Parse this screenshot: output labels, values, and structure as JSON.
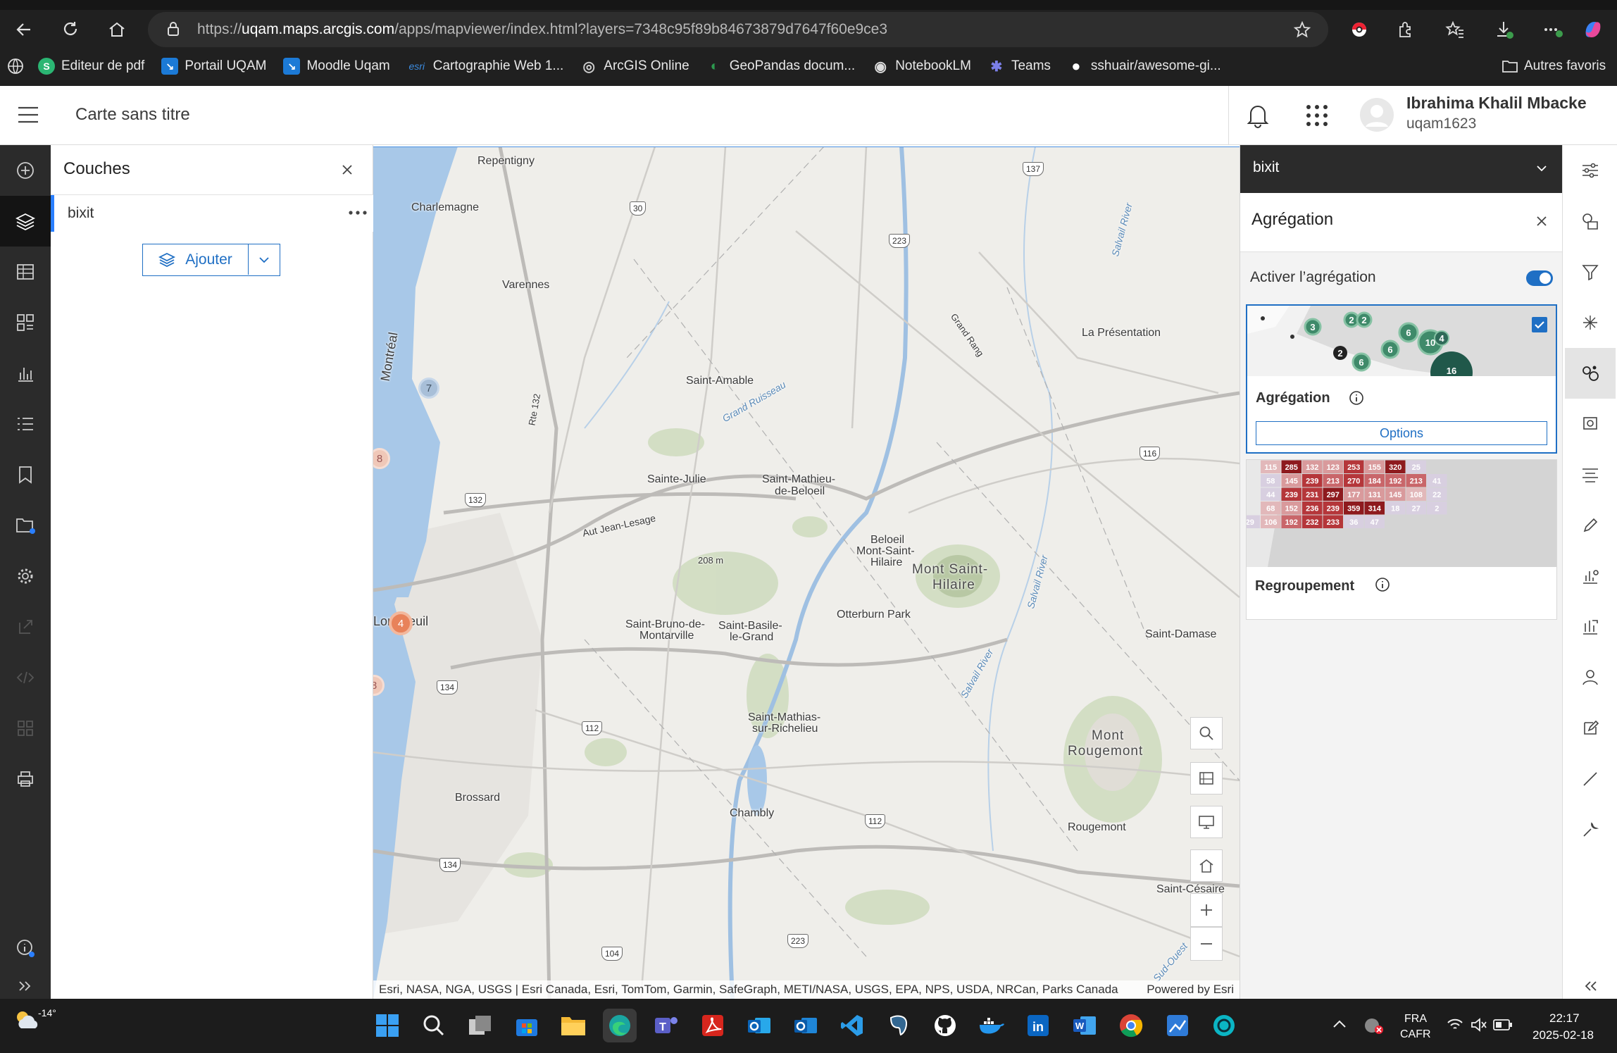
{
  "browser": {
    "url_prefix": "https://",
    "url_domain": "uqam.maps.arcgis.com",
    "url_path": "/apps/mapviewer/index.html?layers=7348c95f89b84673879d7647f60e9ce3",
    "bookmarks": [
      {
        "label": "Editeur de pdf",
        "color": "#2bb673",
        "glyph": "S"
      },
      {
        "label": "Portail UQAM",
        "color": "#1c7ad6",
        "glyph": "↘"
      },
      {
        "label": "Moodle Uqam",
        "color": "#1c7ad6",
        "glyph": "↘"
      },
      {
        "label": "Cartographie Web 1...",
        "color": "#2c6fb7",
        "glyph": "esri"
      },
      {
        "label": "ArcGIS Online",
        "color": "#444",
        "glyph": "◎"
      },
      {
        "label": "GeoPandas docum...",
        "color": "#1a7f3c",
        "glyph": "◐"
      },
      {
        "label": "NotebookLM",
        "color": "#555",
        "glyph": "◉"
      },
      {
        "label": "Teams",
        "color": "#5b5fc7",
        "glyph": "✱"
      },
      {
        "label": "sshuair/awesome-gi...",
        "color": "#333",
        "glyph": "●"
      }
    ],
    "other_bookmarks": "Autres favoris"
  },
  "header": {
    "map_title": "Carte sans titre",
    "user_name": "Ibrahima Khalil Mbacke",
    "user_id": "uqam1623"
  },
  "layers_panel": {
    "title": "Couches",
    "layer_name": "bixit",
    "add_label": "Ajouter"
  },
  "right_panel": {
    "layer_select": "bixit",
    "title": "Agrégation",
    "toggle_label": "Activer l’agrégation",
    "toggle_on": true,
    "card1": {
      "title": "Agrégation",
      "options_label": "Options",
      "selected": true,
      "cluster_values": [
        "3",
        "2",
        "2",
        "6",
        "4",
        "10",
        "2",
        "6",
        "6",
        "16"
      ]
    },
    "card2": {
      "title": "Regroupement",
      "grid_values": [
        [
          "",
          "115",
          "285",
          "132",
          "123",
          "253",
          "155",
          "320",
          "25"
        ],
        [
          "",
          "58",
          "145",
          "239",
          "213",
          "270",
          "184",
          "192",
          "213",
          "41"
        ],
        [
          "",
          "44",
          "239",
          "231",
          "297",
          "177",
          "131",
          "145",
          "108",
          "22"
        ],
        [
          "",
          "68",
          "152",
          "236",
          "239",
          "359",
          "314",
          "18",
          "27",
          "2"
        ],
        [
          "29",
          "106",
          "192",
          "232",
          "233",
          "36",
          "47"
        ]
      ]
    }
  },
  "map": {
    "places": [
      {
        "name": "Repentigny"
      },
      {
        "name": "Charlemagne"
      },
      {
        "name": "Varennes"
      },
      {
        "name": "Saint-Amable"
      },
      {
        "name": "La Présentation"
      },
      {
        "name": "Sainte-Julie"
      },
      {
        "name": "Saint-Mathieu-"
      },
      {
        "name": "de-Beloeil"
      },
      {
        "name": "Beloeil"
      },
      {
        "name": "Mont-Saint-"
      },
      {
        "name": "Hilaire"
      },
      {
        "name": "Mont Saint-"
      },
      {
        "name": "Hilaire"
      },
      {
        "name": "Otterburn Park"
      },
      {
        "name": "Saint-Bruno-de-"
      },
      {
        "name": "Montarville"
      },
      {
        "name": "Saint-Basile-"
      },
      {
        "name": "le-Grand"
      },
      {
        "name": "Saint-Damase"
      },
      {
        "name": "Saint-Mathias-"
      },
      {
        "name": "sur-Richelieu"
      },
      {
        "name": "Brossard"
      },
      {
        "name": "Chambly"
      },
      {
        "name": "Mont"
      },
      {
        "name": "Rougemont"
      },
      {
        "name": "Rougemont"
      },
      {
        "name": "Saint-Césaire"
      },
      {
        "name": "Longueuil"
      },
      {
        "name": "Montréal"
      },
      {
        "name": "208 m"
      }
    ],
    "water": [
      {
        "name": "Grand Ruisseau"
      },
      {
        "name": "Salvail River"
      },
      {
        "name": "Salvail River"
      },
      {
        "name": "Salvail River"
      },
      {
        "name": "Sud-Ouest"
      }
    ],
    "roads": [
      {
        "name": "Aut Jean-Lesage"
      },
      {
        "name": "Grand Rang"
      },
      {
        "name": "Rte 132"
      }
    ],
    "shields": [
      "137",
      "30",
      "223",
      "116",
      "132",
      "134",
      "112",
      "112",
      "134",
      "104",
      "223"
    ],
    "clusters": [
      "7",
      "8",
      "4",
      "8"
    ],
    "attribution": "Esri, NASA, NGA, USGS | Esri Canada, Esri, TomTom, Garmin, SafeGraph, METI/NASA, USGS, EPA, NPS, USDA, NRCan, Parks Canada",
    "powered_by": "Powered by Esri"
  },
  "taskbar": {
    "temperature": "-14°",
    "lang1": "FRA",
    "lang2": "CAFR",
    "time": "22:17",
    "date": "2025-02-18"
  }
}
